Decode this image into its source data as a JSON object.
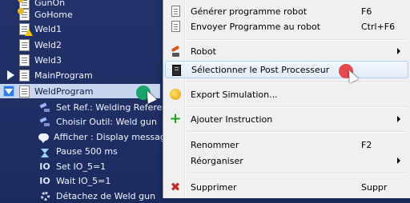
{
  "tree": {
    "items": [
      {
        "label": "GunOn",
        "type": "program",
        "badge": "gold"
      },
      {
        "label": "GoHome",
        "type": "program",
        "badge": "gold"
      },
      {
        "label": "Weld1",
        "type": "program",
        "badge": "warn"
      },
      {
        "label": "Weld2",
        "type": "program",
        "badge": "none"
      },
      {
        "label": "Weld3",
        "type": "program",
        "badge": "none"
      },
      {
        "label": "MainProgram",
        "type": "program",
        "badge": "none",
        "expander": "collapsed"
      },
      {
        "label": "WeldProgram",
        "type": "program",
        "badge": "none",
        "expander": "expanded",
        "selected": true
      }
    ],
    "instructions": [
      {
        "label": "Set Ref.: Welding Refere",
        "icon": "frame-icon"
      },
      {
        "label": "Choisir Outil: Weld gun",
        "icon": "robot-icon"
      },
      {
        "label": "Afficher : Display message",
        "icon": "speech-icon"
      },
      {
        "label": "Pause 500 ms",
        "icon": "hourglass-icon"
      },
      {
        "label": "Set IO_5=1",
        "icon": "io-icon",
        "icon_text": "IO"
      },
      {
        "label": "Wait IO_5=1",
        "icon": "io-icon",
        "icon_text": "IO"
      },
      {
        "label": "Détachez de Weld gun",
        "icon": "gear-icon"
      }
    ]
  },
  "context_menu": {
    "items": [
      {
        "label": "Générer programme robot",
        "shortcut": "F6",
        "icon": "document-icon"
      },
      {
        "label": "Envoyer Programme au robot",
        "shortcut": "Ctrl+F6",
        "icon": "document-icon"
      },
      {
        "label": "Robot",
        "shortcut": "",
        "icon": "robot-icon",
        "submenu": true
      },
      {
        "label": "Sélectionner le Post Processeur",
        "shortcut": "",
        "icon": "post-processor-icon",
        "hover": true
      },
      {
        "label": "Export Simulation...",
        "shortcut": "",
        "icon": "export-icon"
      },
      {
        "label": "Ajouter Instruction",
        "shortcut": "",
        "icon": "plus-icon",
        "submenu": true
      },
      {
        "label": "Renommer",
        "shortcut": "F2",
        "icon": "none"
      },
      {
        "label": "Réorganiser",
        "shortcut": "",
        "icon": "none",
        "submenu": true
      },
      {
        "label": "Supprimer",
        "shortcut": "Suppr",
        "icon": "delete-icon"
      }
    ]
  },
  "colors": {
    "tree_background": "#1f2e62",
    "selection": "#c7d6ee",
    "menu_background": "#f0f0f0",
    "hover_border": "#aecff7",
    "click_marker_tree": "#1aa36b",
    "click_marker_menu": "#e5484d"
  }
}
